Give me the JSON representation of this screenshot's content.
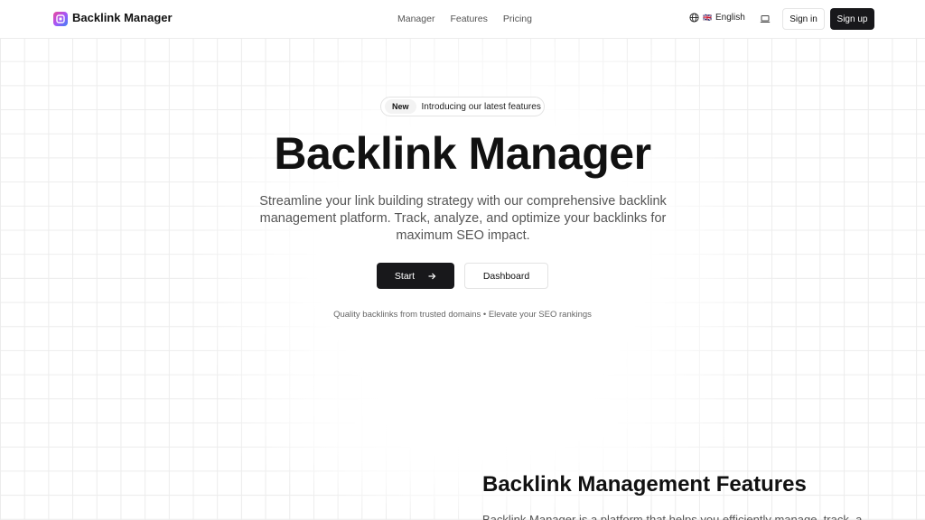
{
  "header": {
    "brand": "Backlink Manager",
    "nav": [
      {
        "label": "Manager"
      },
      {
        "label": "Features"
      },
      {
        "label": "Pricing"
      }
    ],
    "language": {
      "flag": "🇬🇧",
      "label": "English"
    },
    "signin_label": "Sign in",
    "signup_label": "Sign up"
  },
  "hero": {
    "badge_pill": "New",
    "badge_text": "Introducing our latest features",
    "title": "Backlink Manager",
    "description": "Streamline your link building strategy with our comprehensive backlink management platform. Track, analyze, and optimize your backlinks for maximum SEO impact.",
    "start_label": "Start",
    "dashboard_label": "Dashboard",
    "tagline": "Quality backlinks from trusted domains • Elevate your SEO rankings"
  },
  "features": {
    "title": "Backlink Management Features",
    "description": "Backlink Manager is a platform that helps you efficiently manage, track, and"
  },
  "colors": {
    "primary": "#18181b",
    "grid": "#ececec"
  }
}
